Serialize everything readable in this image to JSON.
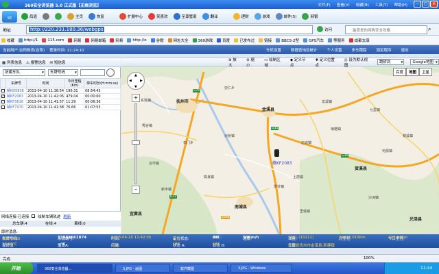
{
  "window": {
    "title": "360安全浏览器 5.0 正式版【无痕浏览】",
    "menu": [
      "文件(F)",
      "查看(V)",
      "收藏(B)",
      "工具(T)",
      "帮助(H)"
    ]
  },
  "toolbar": {
    "back": "后退",
    "home": "主页",
    "restore": "恢复",
    "ext": "扩展中心",
    "funny": "笑喜欢",
    "steward": "至尊管家",
    "translate": "翻译",
    "finance": "理财",
    "game": "游戏",
    "mail": "邮件(5)",
    "net": "网银"
  },
  "address": {
    "label": "地址",
    "url": "http://220.231.180.36/webgps",
    "go": "访问",
    "search_placeholder": "最喜爱的网购安全攻略"
  },
  "favorites": [
    "收藏",
    "http://1",
    "115.com",
    "网易",
    "网易邮箱",
    "网易",
    "http://o",
    "谷歌",
    "网址大全",
    "360游戏",
    "百度",
    "已发布过",
    "链接",
    "BBCS-2型",
    "GPS汽车",
    "等服务",
    "成都太康"
  ],
  "app": {
    "user": "当前用户:吉阳物流(吉阳)",
    "login": "登录时间: 11:24:10",
    "menu": [
      "车机设置",
      "数据查询及统计",
      "个人设置",
      "多车跟踪",
      "锁定程序",
      "退出"
    ]
  },
  "left": {
    "tabs": [
      "列表信息",
      "报警信息",
      "短信息"
    ],
    "fleet": "所属车队",
    "plate_select": "车牌号码",
    "columns": [
      "车牌号",
      "时间",
      "今日里程(Km)",
      "停车时长(H:mm:ss)"
    ],
    "rows": [
      {
        "plate": "赣KD5836",
        "time": "2013-04-10 11:38:54",
        "km": "196.31",
        "stop": "08:54:43"
      },
      {
        "plate": "赣KF2083",
        "time": "2013-04-10 11:42:05",
        "km": "479.04",
        "stop": "00:00:00"
      },
      {
        "plate": "赣KF3616",
        "time": "2013-04-10 11:41:57",
        "km": "11.29",
        "stop": "00:06:36"
      },
      {
        "plate": "赣KF7970",
        "time": "2013-04-10 11:41:38",
        "km": "76.66",
        "stop": "01:07:53"
      }
    ],
    "net_status": "网络连接:已连接",
    "draw_track": "绘制车辆轨迹",
    "refresh": "刷新",
    "total_label": "总车辆:",
    "total": "4",
    "online_label": "在线:",
    "online": "4",
    "offline_label": "离线:",
    "offline": "0",
    "instant": "即时消息:"
  },
  "map_toolbar": [
    "放大",
    "缩小",
    "绘制区域",
    "定义节点",
    "定义位置点",
    "设为默认视图"
  ],
  "map_controls": {
    "jump": "跳转到",
    "provider": "Google地图",
    "types": [
      "百度",
      "地图",
      "卫星"
    ]
  },
  "map_labels": {
    "cities": [
      "抚州市",
      "金溪县",
      "南城县",
      "宜黄县",
      "资溪县"
    ],
    "towns": [
      "东馆镇",
      "龙溪镇",
      "秀谷镇",
      "七里镇",
      "石门乡",
      "对桥镇",
      "合市镇",
      "左坊镇",
      "琅琚镇",
      "黎溪镇",
      "何源镇",
      "株良镇",
      "上唐镇",
      "新丰镇",
      "罗针镇",
      "崇仁乡",
      "里塔镇",
      "沙洲镇",
      "光泽县"
    ],
    "roads": [
      "G70",
      "G35",
      "G36",
      "G72",
      "S308"
    ],
    "vehicle": "赣KF2083"
  },
  "status": {
    "plate_label": "车牌号码:",
    "plate": "赣KF2083",
    "sys_label": "系统编号:",
    "sys": "13954661874",
    "time_label": "时间:",
    "time": "2013-04-10 11:42:05",
    "state_label": "定位状态:",
    "state": "实位",
    "acc_label": "ACC:",
    "acc": "ON",
    "speed_label": "速度:",
    "speed": "50Km/h",
    "odo_label": "油量:",
    "odo": "351L (10211)",
    "total_km_label": "总里程:",
    "total_km": "24317.015Km",
    "today_km_label": "今日里程:",
    "today_km": "479.04Km",
    "temp_label": "温度值:",
    "temp": "27.93℃",
    "t2_label": "温度A:",
    "t2": "--℃",
    "door_label": "门磁:",
    "door": "关闭",
    "door2_label": "状态 A:",
    "door2": "OFF",
    "oil_label": "状态 B:",
    "oil": "OFF",
    "pos_label": "位置:",
    "pos": "江西省抚州市金溪县,新建镇"
  },
  "browser_status": {
    "left": "完成",
    "zoom": "100%"
  },
  "taskbar": {
    "start": "开始",
    "tasks": [
      "360安全浏览器...",
      "3.JPG - 画图",
      "软件截图",
      "3.JPG - Windows"
    ],
    "time": "11:44"
  }
}
